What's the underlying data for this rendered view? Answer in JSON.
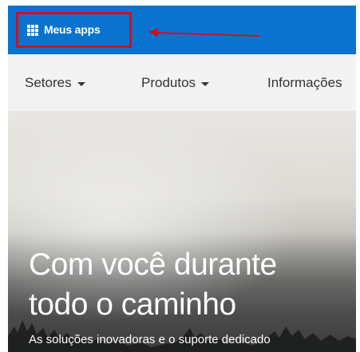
{
  "topbar": {
    "apps_label": "Meus apps",
    "color": "#0a73cf",
    "highlight_color": "#d0111b"
  },
  "nav": {
    "items": [
      {
        "label": "Setores",
        "has_dropdown": true
      },
      {
        "label": "Produtos",
        "has_dropdown": true
      },
      {
        "label": "Informações",
        "has_dropdown": false
      }
    ]
  },
  "hero": {
    "title_line1": "Com você durante",
    "title_line2": "todo o caminho",
    "subtitle": "As soluções inovadoras e o suporte dedicado"
  }
}
